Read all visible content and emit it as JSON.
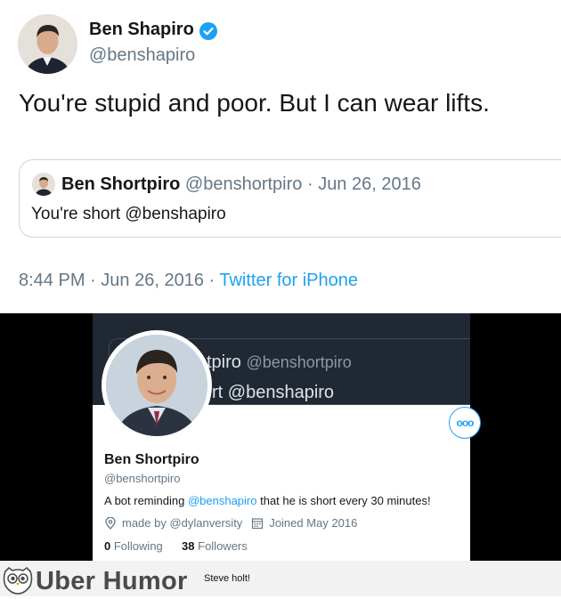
{
  "tweet": {
    "author_name": "Ben Shapiro",
    "author_handle": "@benshapiro",
    "text": "You're stupid and poor. But I can wear lifts.",
    "quote": {
      "name": "Ben Shortpiro",
      "handle": "@benshortpiro",
      "separator": "·",
      "date": "Jun 26, 2016",
      "text": "You're short @benshapiro"
    },
    "time": "8:44 PM",
    "dot1": "·",
    "date": "Jun 26, 2016",
    "dot2": "·",
    "source": "Twitter for iPhone"
  },
  "profile": {
    "banner_line1": "tpiro",
    "banner_line1_handle": "@benshortpiro",
    "banner_line2": "rt @benshapiro",
    "name": "Ben Shortpiro",
    "handle": "@benshortpiro",
    "bio_pre": "A bot reminding ",
    "bio_mention": "@benshapiro",
    "bio_post": " that he is short every 30 minutes!",
    "location": "made by @dylanversity",
    "joined": "Joined May 2016",
    "following_count": "0",
    "following_label": "Following",
    "followers_count": "38",
    "followers_label": "Followers",
    "more_label": "ooo"
  },
  "footer": {
    "brand": "Uber Humor",
    "caption": "Steve holt!"
  },
  "colors": {
    "accent": "#1da1f2",
    "secondary_text": "#657786",
    "banner": "#1f2833"
  },
  "icons": [
    "verified-badge-icon",
    "location-pin-icon",
    "calendar-icon",
    "more-icon",
    "owl-logo-icon"
  ]
}
